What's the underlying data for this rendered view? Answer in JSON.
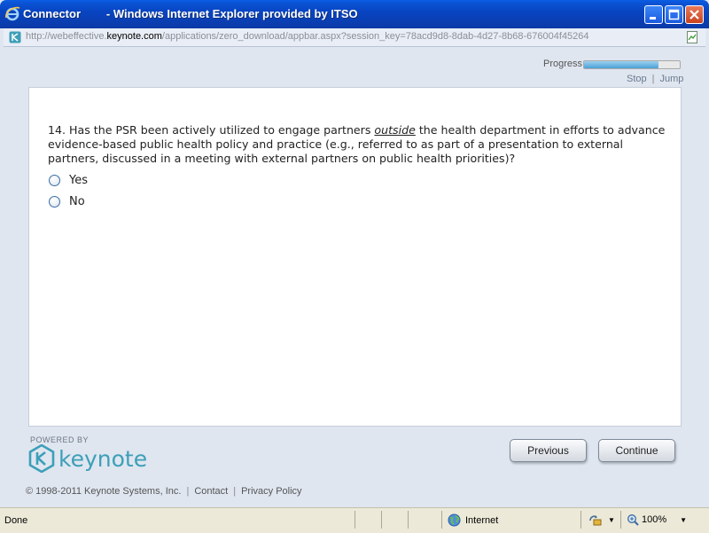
{
  "window": {
    "title": "Connector        - Windows Internet Explorer provided by ITSO"
  },
  "address": {
    "url_prefix": "http://webeffective.",
    "url_domain": "keynote.com",
    "url_suffix": "/applications/zero_download/appbar.aspx?session_key=78acd9d8-8dab-4d27-8b68-676004f45264"
  },
  "toolbar": {
    "progress_label": "Progress",
    "progress_fraction": 0.78,
    "stop_label": "Stop",
    "jump_label": "Jump",
    "separator": "|"
  },
  "question": {
    "number_text": "14. Has the PSR been actively utilized to engage partners ",
    "emphasis": "outside",
    "rest_text": " the health department in efforts to advance evidence-based public health policy and practice (e.g., referred to as part of a presentation to external partners, discussed in a meeting with external partners on public health priorities)?",
    "options": [
      {
        "label": "Yes",
        "selected": false
      },
      {
        "label": "No",
        "selected": false
      }
    ]
  },
  "branding": {
    "powered_by": "POWERED BY",
    "brand_name": "keynote",
    "brand_color": "#3d9fb8"
  },
  "buttons": {
    "previous": "Previous",
    "continue": "Continue"
  },
  "footer": {
    "copyright": "© 1998-2011 Keynote Systems, Inc.",
    "contact": "Contact",
    "privacy": "Privacy Policy",
    "separator": "|"
  },
  "statusbar": {
    "status_text": "Done",
    "zone": "Internet",
    "zoom": "100%"
  }
}
